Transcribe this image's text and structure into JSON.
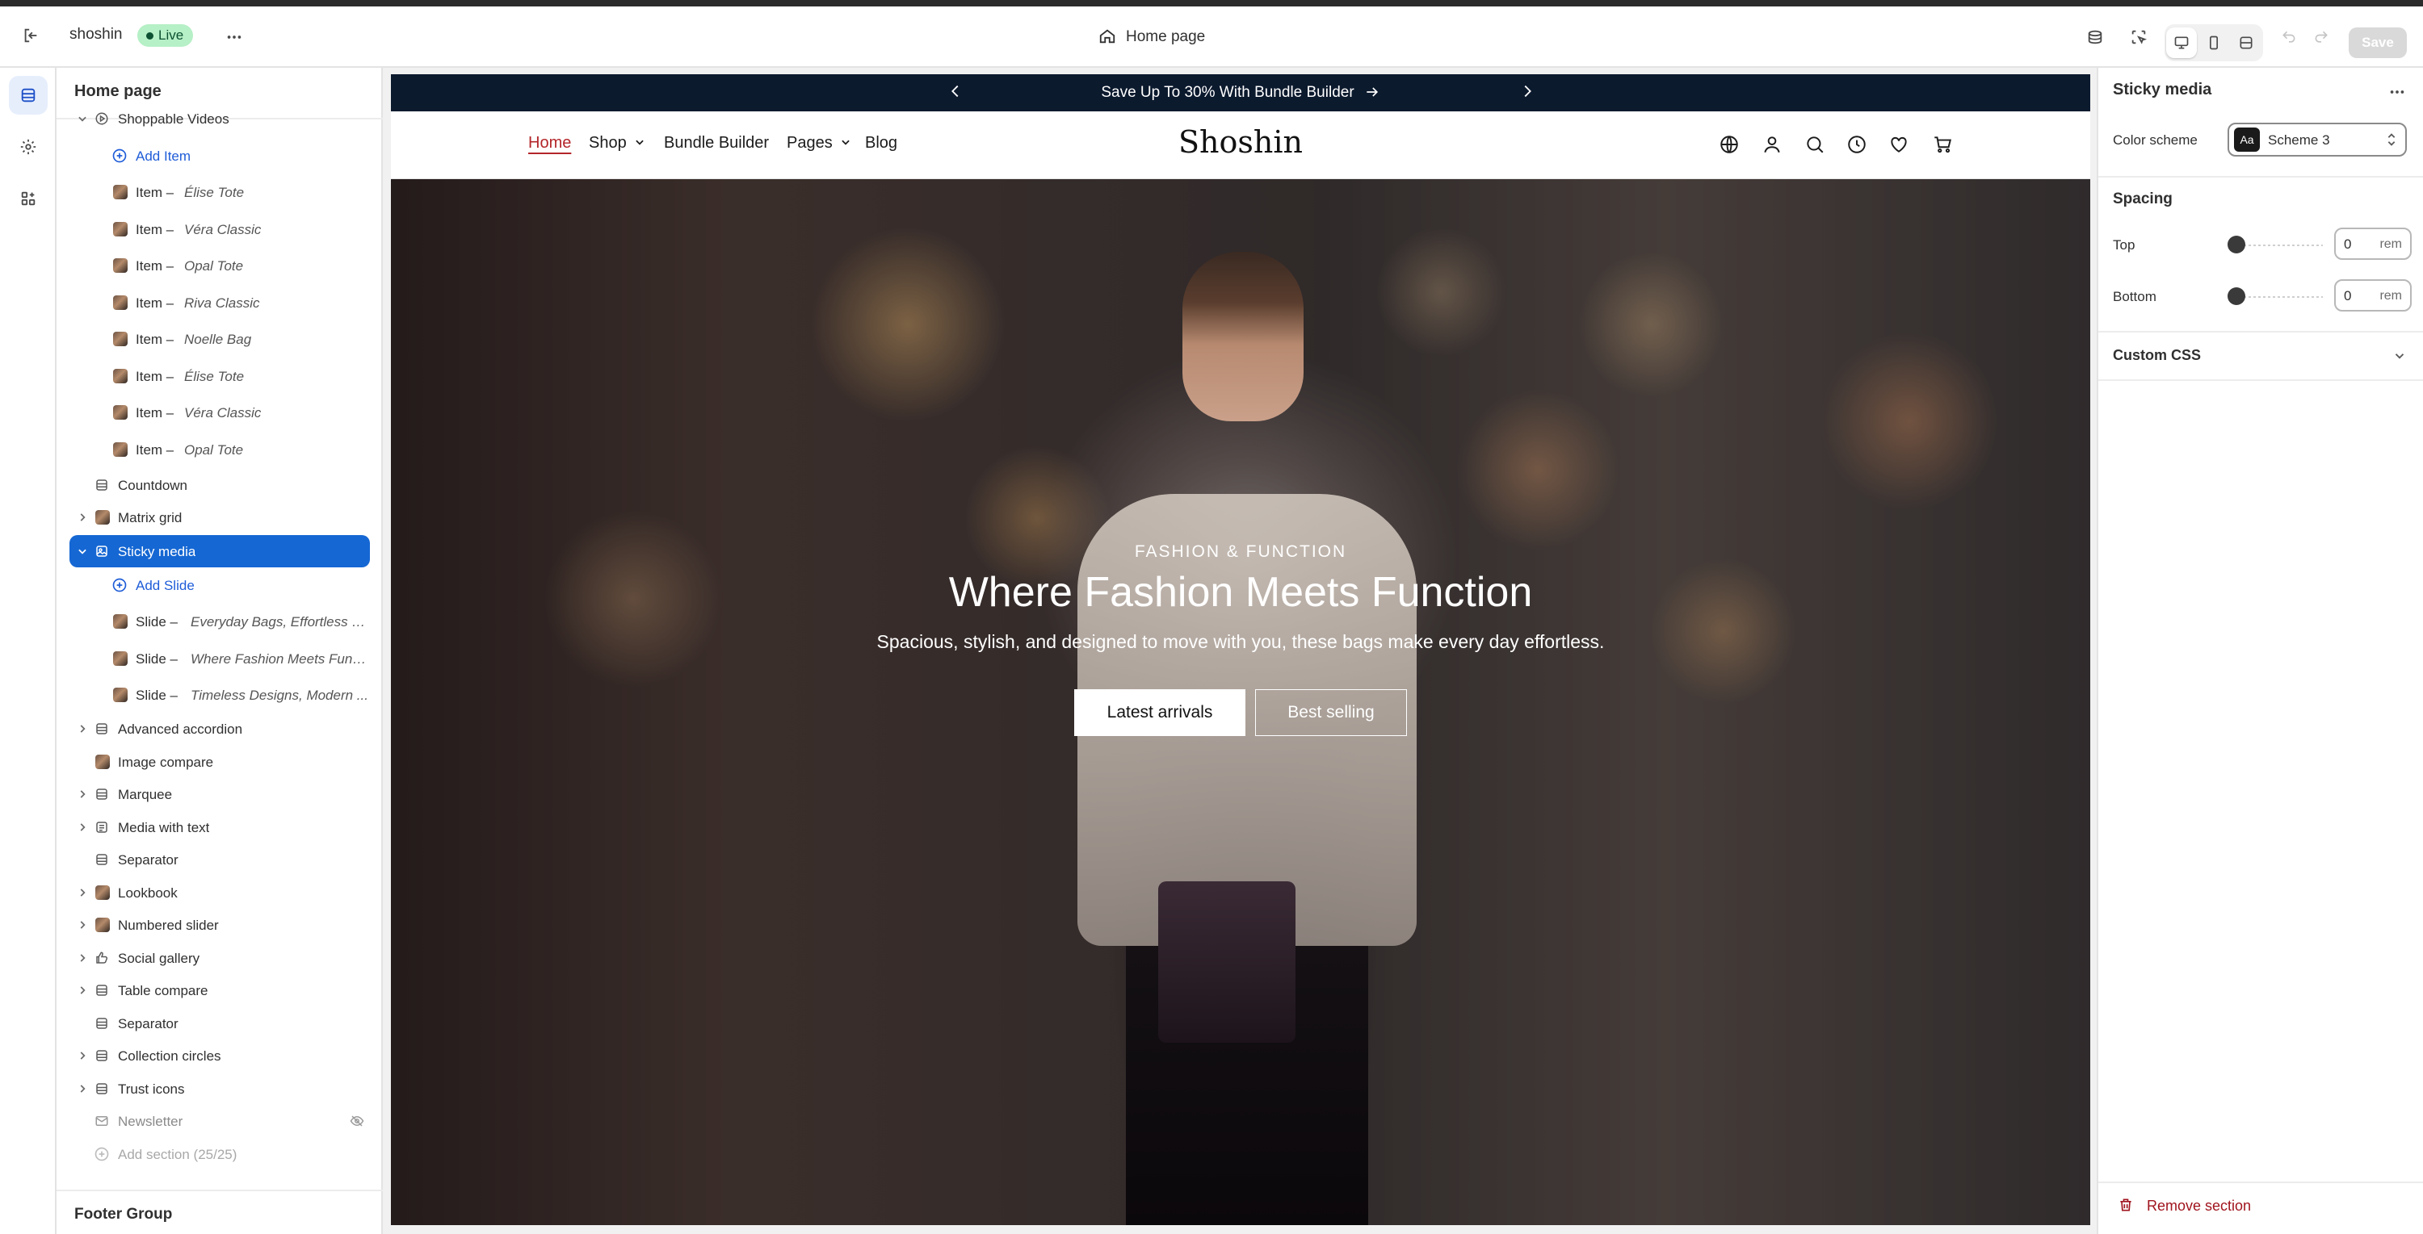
{
  "topbar": {
    "store_name": "shoshin",
    "status_badge": "Live",
    "page_title": "Home page",
    "save_label": "Save"
  },
  "left_panel": {
    "title": "Home page",
    "footer_group": "Footer Group",
    "rows": [
      {
        "label": "Shoppable Videos",
        "kind": "section",
        "expanded": true
      },
      {
        "label": "Add Item",
        "kind": "add"
      },
      {
        "prefix": "Item – ",
        "label": "Élise Tote",
        "kind": "block"
      },
      {
        "prefix": "Item – ",
        "label": "Véra Classic",
        "kind": "block"
      },
      {
        "prefix": "Item – ",
        "label": "Opal Tote",
        "kind": "block"
      },
      {
        "prefix": "Item – ",
        "label": "Riva Classic",
        "kind": "block"
      },
      {
        "prefix": "Item – ",
        "label": "Noelle Bag",
        "kind": "block"
      },
      {
        "prefix": "Item – ",
        "label": "Élise Tote",
        "kind": "block"
      },
      {
        "prefix": "Item – ",
        "label": "Véra Classic",
        "kind": "block"
      },
      {
        "prefix": "Item – ",
        "label": "Opal Tote",
        "kind": "block"
      },
      {
        "label": "Countdown",
        "kind": "section"
      },
      {
        "label": "Matrix grid",
        "kind": "section"
      },
      {
        "label": "Sticky media",
        "kind": "section",
        "selected": true
      },
      {
        "label": "Add Slide",
        "kind": "add"
      },
      {
        "prefix": "Slide – ",
        "label": "Everyday Bags, Effortless S...",
        "kind": "block"
      },
      {
        "prefix": "Slide – ",
        "label": "Where Fashion Meets Funct...",
        "kind": "block"
      },
      {
        "prefix": "Slide – ",
        "label": "Timeless Designs, Modern ...",
        "kind": "block"
      },
      {
        "label": "Advanced accordion",
        "kind": "section"
      },
      {
        "label": "Image compare",
        "kind": "section"
      },
      {
        "label": "Marquee",
        "kind": "section"
      },
      {
        "label": "Media with text",
        "kind": "section"
      },
      {
        "label": "Separator",
        "kind": "section"
      },
      {
        "label": "Lookbook",
        "kind": "section"
      },
      {
        "label": "Numbered slider",
        "kind": "section"
      },
      {
        "label": "Social gallery",
        "kind": "section"
      },
      {
        "label": "Table compare",
        "kind": "section"
      },
      {
        "label": "Separator",
        "kind": "section"
      },
      {
        "label": "Collection circles",
        "kind": "section"
      },
      {
        "label": "Trust icons",
        "kind": "section"
      },
      {
        "label": "Newsletter",
        "kind": "section",
        "hidden": true
      },
      {
        "label": "Add section (25/25)",
        "kind": "add-disabled"
      }
    ]
  },
  "preview": {
    "announcement": "Save Up To 30% With Bundle Builder",
    "logo": "Shoshin",
    "nav": [
      "Home",
      "Shop",
      "Bundle Builder",
      "Pages",
      "Blog"
    ],
    "hero": {
      "eyebrow": "FASHION & FUNCTION",
      "heading": "Where Fashion Meets Function",
      "subtext": "Spacious, stylish, and designed to move with you, these bags make every day effortless.",
      "primary_button": "Latest arrivals",
      "secondary_button": "Best selling"
    }
  },
  "right_panel": {
    "title": "Sticky media",
    "color_scheme_label": "Color scheme",
    "color_scheme_value": "Scheme 3",
    "swatch_text": "Aa",
    "spacing_heading": "Spacing",
    "top_label": "Top",
    "top_value": "0",
    "bottom_label": "Bottom",
    "bottom_value": "0",
    "unit": "rem",
    "custom_css": "Custom CSS",
    "remove_section": "Remove section"
  },
  "colors": {
    "accent_blue": "#1567d3",
    "announce_bg": "#0c1a2e",
    "live_badge": "#b6f0c6",
    "danger": "#a0141e"
  }
}
